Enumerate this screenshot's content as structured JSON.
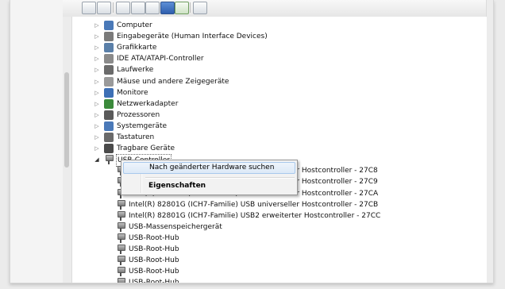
{
  "device_manager": {
    "categories": [
      {
        "label": "Computer",
        "icon": "computer-icon"
      },
      {
        "label": "Eingabegeräte (Human Interface Devices)",
        "icon": "hid-icon"
      },
      {
        "label": "Grafikkarte",
        "icon": "display-adapter-icon"
      },
      {
        "label": "IDE ATA/ATAPI-Controller",
        "icon": "ide-controller-icon"
      },
      {
        "label": "Laufwerke",
        "icon": "disk-drive-icon"
      },
      {
        "label": "Mäuse und andere Zeigegeräte",
        "icon": "mouse-icon"
      },
      {
        "label": "Monitore",
        "icon": "monitor-icon"
      },
      {
        "label": "Netzwerkadapter",
        "icon": "network-adapter-icon"
      },
      {
        "label": "Prozessoren",
        "icon": "processor-icon"
      },
      {
        "label": "Systemgeräte",
        "icon": "system-devices-icon"
      },
      {
        "label": "Tastaturen",
        "icon": "keyboard-icon"
      },
      {
        "label": "Tragbare Geräte",
        "icon": "portable-devices-icon"
      }
    ],
    "usb_controller": {
      "label": "USB-Controller",
      "icon": "usb-plug-icon",
      "expanded": true,
      "children": [
        "Intel(R) 82801G (ICH7-Familie) USB universeller Hostcontroller - 27C8",
        "Intel(R) 82801G (ICH7-Familie) USB universeller Hostcontroller - 27C9",
        "Intel(R) 82801G (ICH7-Familie) USB universeller Hostcontroller - 27CA",
        "Intel(R) 82801G (ICH7-Familie) USB universeller Hostcontroller - 27CB",
        "Intel(R) 82801G (ICH7-Familie) USB2 erweiterter Hostcontroller - 27CC",
        "USB-Massenspeichergerät",
        "USB-Root-Hub",
        "USB-Root-Hub",
        "USB-Root-Hub",
        "USB-Root-Hub",
        "USB-Root-Hub"
      ]
    }
  },
  "context_menu": {
    "items": [
      "Nach geänderter Hardware suchen",
      "Eigenschaften"
    ],
    "highlighted": "Nach geänderter Hardware suchen",
    "default_item": "Eigenschaften"
  },
  "colors": {
    "selection_hover": "#dce9f7",
    "menu_background": "#f2f2f2",
    "toolbar_accent": "#2f5fae"
  }
}
